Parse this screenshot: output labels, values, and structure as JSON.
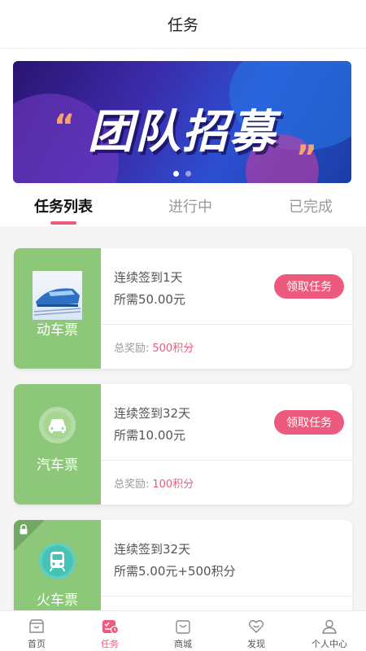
{
  "header": {
    "title": "任务"
  },
  "banner": {
    "headline": "团队招募",
    "quote_open": "“",
    "quote_close": "”",
    "slide_count": 2,
    "active_slide": 1
  },
  "tabs": [
    {
      "label": "任务列表",
      "active": true
    },
    {
      "label": "进行中",
      "active": false
    },
    {
      "label": "已完成",
      "active": false
    }
  ],
  "tasks": [
    {
      "category": "动车票",
      "icon": "train-photo",
      "line1": "连续签到1天",
      "line2": "所需50.00元",
      "reward_label": "总奖励:",
      "reward_value": "500积分",
      "button": "领取任务",
      "locked": false
    },
    {
      "category": "汽车票",
      "icon": "car-icon",
      "line1": "连续签到32天",
      "line2": "所需10.00元",
      "reward_label": "总奖励:",
      "reward_value": "100积分",
      "button": "领取任务",
      "locked": false
    },
    {
      "category": "火车票",
      "icon": "train-icon",
      "line1": "连续签到32天",
      "line2": "所需5.00元+500积分",
      "locked": true
    }
  ],
  "tabbar": [
    {
      "label": "首页",
      "icon": "home-icon",
      "active": false
    },
    {
      "label": "任务",
      "icon": "task-icon",
      "active": true
    },
    {
      "label": "商城",
      "icon": "shop-icon",
      "active": false
    },
    {
      "label": "发现",
      "icon": "discover-icon",
      "active": false
    },
    {
      "label": "个人中心",
      "icon": "profile-icon",
      "active": false
    }
  ],
  "colors": {
    "accent": "#ee5a7e",
    "card_green": "#8dc87a",
    "banner_blue": "#2c4fd1"
  }
}
